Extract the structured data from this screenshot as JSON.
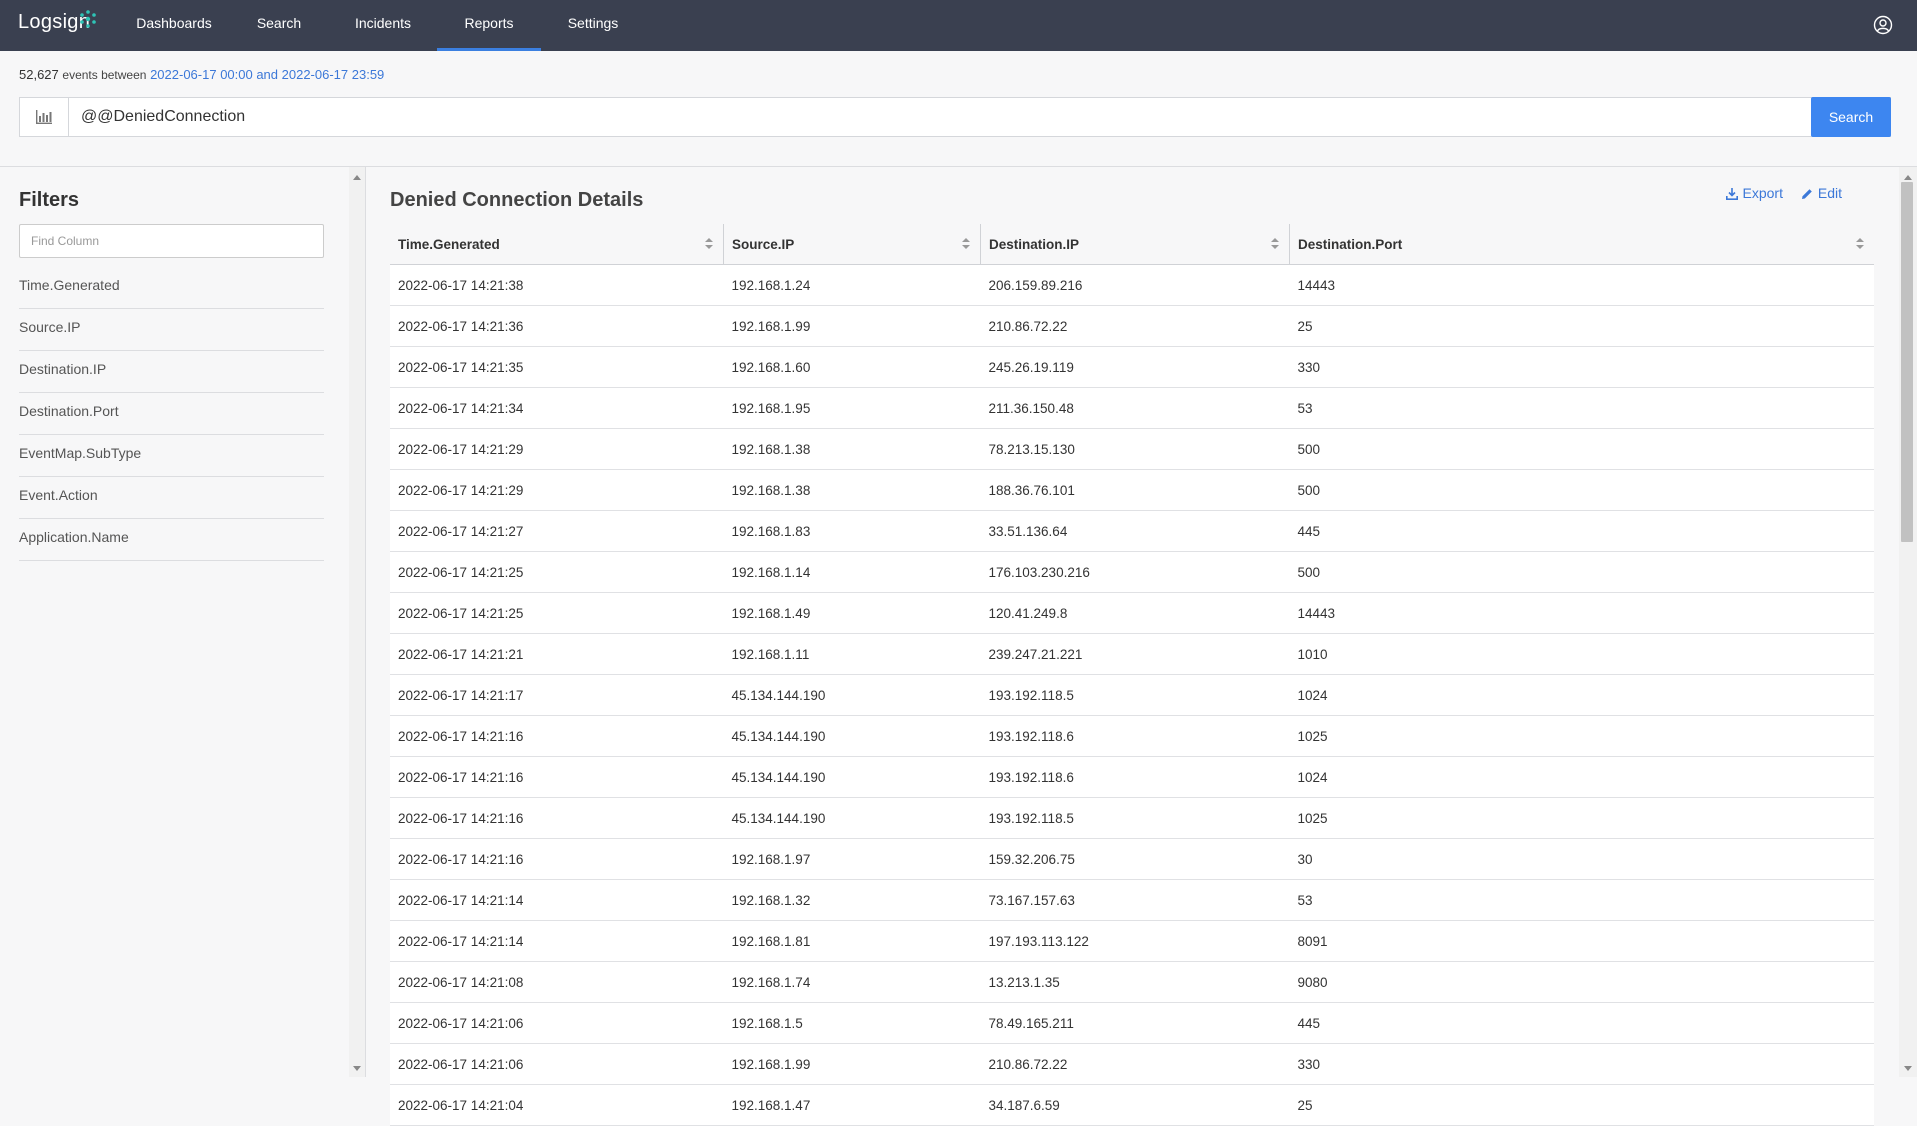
{
  "app": {
    "logo_text": "Logsign",
    "nav": [
      {
        "label": "Dashboards"
      },
      {
        "label": "Search"
      },
      {
        "label": "Incidents"
      },
      {
        "label": "Reports"
      },
      {
        "label": "Settings"
      }
    ],
    "active_nav": "Reports",
    "user_icon": "user-circle-icon"
  },
  "summary": {
    "count": "52,627",
    "events_text": "events between",
    "range_text": "2022-06-17 00:00 and 2022-06-17 23:59"
  },
  "search": {
    "query": "@@DeniedConnection",
    "button_label": "Search",
    "chart_icon": "bar-chart-icon"
  },
  "filters": {
    "title": "Filters",
    "placeholder": "Find Column",
    "items": [
      {
        "label": "Time.Generated"
      },
      {
        "label": "Source.IP"
      },
      {
        "label": "Destination.IP"
      },
      {
        "label": "Destination.Port"
      },
      {
        "label": "EventMap.SubType"
      },
      {
        "label": "Event.Action"
      },
      {
        "label": "Application.Name"
      }
    ]
  },
  "report": {
    "title": "Denied Connection Details",
    "export_label": "Export",
    "edit_label": "Edit",
    "columns": [
      "Time.Generated",
      "Source.IP",
      "Destination.IP",
      "Destination.Port"
    ],
    "rows": [
      [
        "2022-06-17 14:21:38",
        "192.168.1.24",
        "206.159.89.216",
        "14443"
      ],
      [
        "2022-06-17 14:21:36",
        "192.168.1.99",
        "210.86.72.22",
        "25"
      ],
      [
        "2022-06-17 14:21:35",
        "192.168.1.60",
        "245.26.19.119",
        "330"
      ],
      [
        "2022-06-17 14:21:34",
        "192.168.1.95",
        "211.36.150.48",
        "53"
      ],
      [
        "2022-06-17 14:21:29",
        "192.168.1.38",
        "78.213.15.130",
        "500"
      ],
      [
        "2022-06-17 14:21:29",
        "192.168.1.38",
        "188.36.76.101",
        "500"
      ],
      [
        "2022-06-17 14:21:27",
        "192.168.1.83",
        "33.51.136.64",
        "445"
      ],
      [
        "2022-06-17 14:21:25",
        "192.168.1.14",
        "176.103.230.216",
        "500"
      ],
      [
        "2022-06-17 14:21:25",
        "192.168.1.49",
        "120.41.249.8",
        "14443"
      ],
      [
        "2022-06-17 14:21:21",
        "192.168.1.11",
        "239.247.21.221",
        "1010"
      ],
      [
        "2022-06-17 14:21:17",
        "45.134.144.190",
        "193.192.118.5",
        "1024"
      ],
      [
        "2022-06-17 14:21:16",
        "45.134.144.190",
        "193.192.118.6",
        "1025"
      ],
      [
        "2022-06-17 14:21:16",
        "45.134.144.190",
        "193.192.118.6",
        "1024"
      ],
      [
        "2022-06-17 14:21:16",
        "45.134.144.190",
        "193.192.118.5",
        "1025"
      ],
      [
        "2022-06-17 14:21:16",
        "192.168.1.97",
        "159.32.206.75",
        "30"
      ],
      [
        "2022-06-17 14:21:14",
        "192.168.1.32",
        "73.167.157.63",
        "53"
      ],
      [
        "2022-06-17 14:21:14",
        "192.168.1.81",
        "197.193.113.122",
        "8091"
      ],
      [
        "2022-06-17 14:21:08",
        "192.168.1.74",
        "13.213.1.35",
        "9080"
      ],
      [
        "2022-06-17 14:21:06",
        "192.168.1.5",
        "78.49.165.211",
        "445"
      ],
      [
        "2022-06-17 14:21:06",
        "192.168.1.99",
        "210.86.72.22",
        "330"
      ],
      [
        "2022-06-17 14:21:04",
        "192.168.1.47",
        "34.187.6.59",
        "25"
      ]
    ]
  },
  "colors": {
    "nav_bg": "#3a4050",
    "accent": "#3d86f0",
    "link": "#3c78d8"
  }
}
